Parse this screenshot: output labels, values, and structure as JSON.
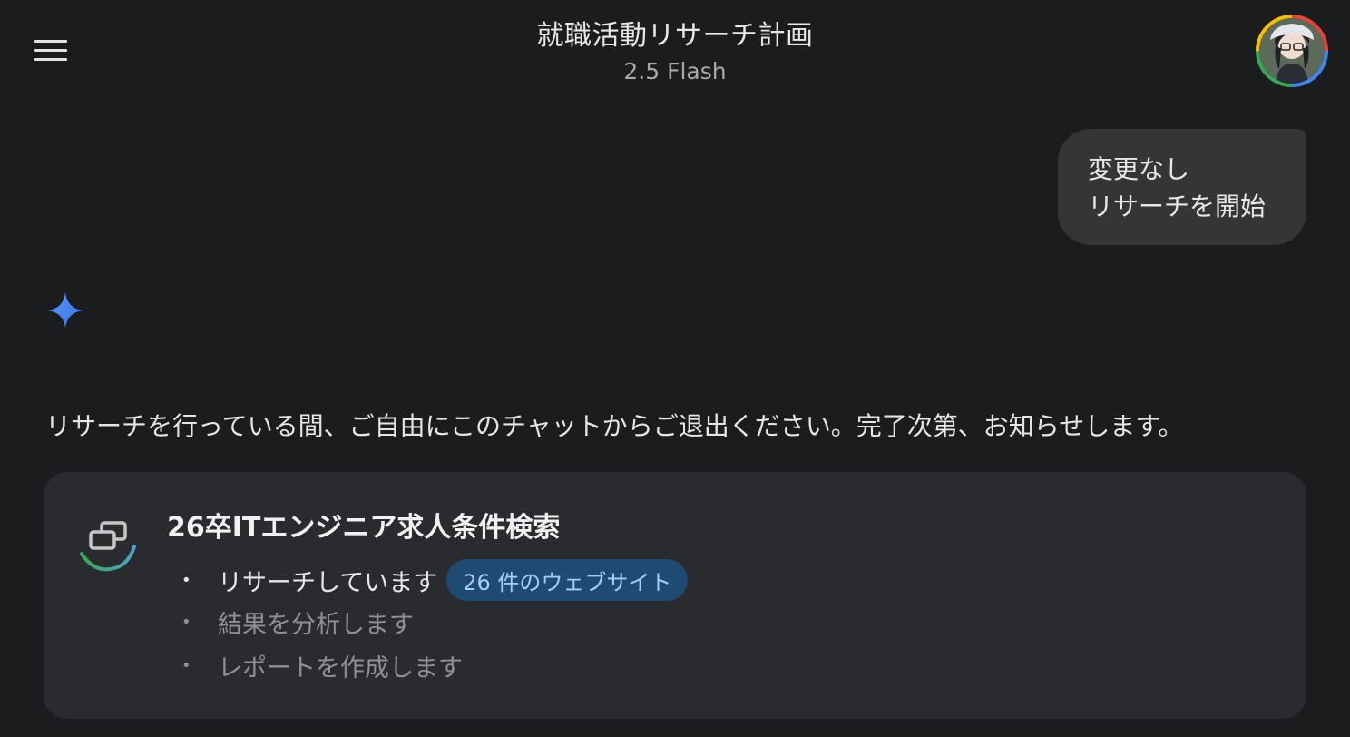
{
  "header": {
    "title": "就職活動リサーチ計画",
    "model": "2.5 Flash",
    "menu_icon": "hamburger-menu-icon",
    "avatar_icon": "user-avatar"
  },
  "user_message": {
    "line1": "変更なし",
    "line2": "リサーチを開始"
  },
  "assistant": {
    "icon": "gemini-spark-icon",
    "status_text": "リサーチを行っている間、ご自由にこのチャットからご退出ください。完了次第、お知らせします。"
  },
  "research_card": {
    "title": "26卒ITエンジニア求人条件検索",
    "steps": [
      {
        "label": "リサーチしています",
        "state": "active",
        "chip": "26 件のウェブサイト"
      },
      {
        "label": "結果を分析します",
        "state": "pending"
      },
      {
        "label": "レポートを作成します",
        "state": "pending"
      }
    ]
  },
  "colors": {
    "background": "#1b1c1e",
    "bubble": "#333537",
    "card": "#2a2b2e",
    "chip_bg": "#1f4a72",
    "chip_text": "#a8cdf5",
    "spark": "#4c8df6"
  }
}
